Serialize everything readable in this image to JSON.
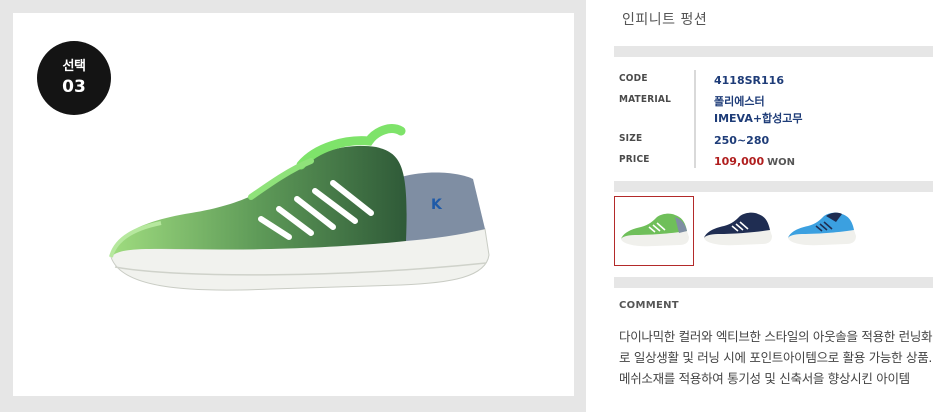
{
  "badge": {
    "label": "선택",
    "number": "03"
  },
  "product": {
    "title": "인피니트 펑션",
    "specs": [
      {
        "key": "CODE",
        "value": "4118SR116"
      },
      {
        "key": "MATERIAL",
        "value": "폴리에스터",
        "value2": "IMEVA+합성고무"
      },
      {
        "key": "SIZE",
        "value": "250~280"
      },
      {
        "key": "PRICE",
        "value": "109,000",
        "unit": "WON"
      }
    ]
  },
  "thumbnails": [
    {
      "color": "green",
      "selected": true
    },
    {
      "color": "navy",
      "selected": false
    },
    {
      "color": "sky-blue",
      "selected": false
    }
  ],
  "colors": {
    "green": "#6fbf5a",
    "navy": "#1f2d52",
    "sky_blue": "#3ba0e0",
    "price_red": "#b01e1e",
    "value_blue": "#1e3c78"
  },
  "comment": {
    "label": "COMMENT",
    "text": "다이나믹한 컬러와 엑티브한 스타일의 아웃솔을 적용한 런닝화로 일상생활 및 러닝 시에 포인트아이템으로 활용 가능한 상품. 메쉬소재를 적용하여 통기성 및 신축서을 향상시킨 아이템"
  }
}
